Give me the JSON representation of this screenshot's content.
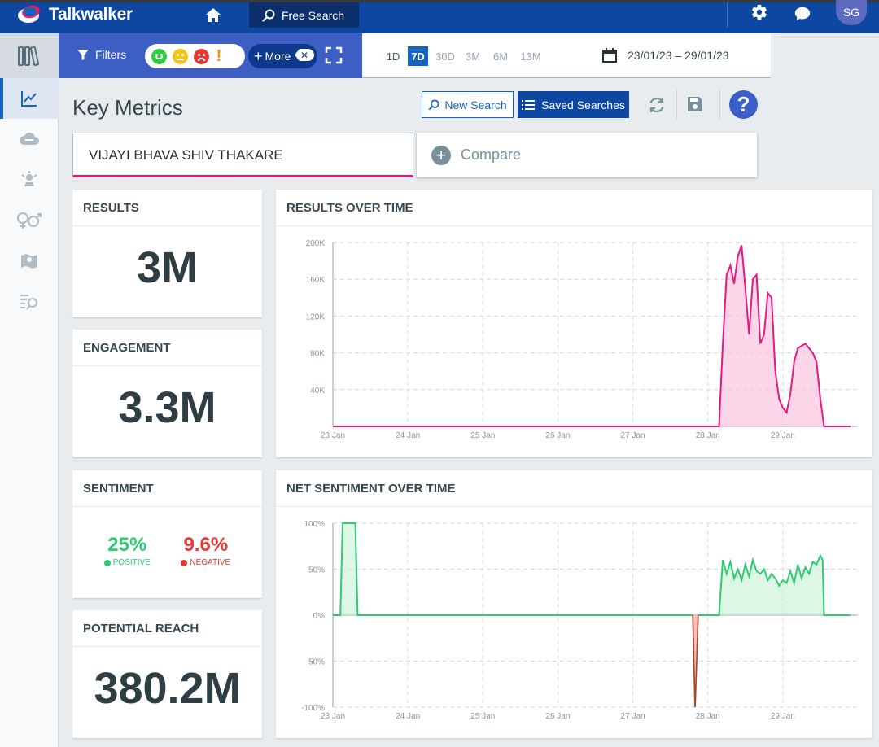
{
  "app": {
    "name": "Talkwalker",
    "free_search": "Free Search",
    "avatar": "SG"
  },
  "filters": {
    "label": "Filters",
    "more": "More",
    "more_close": "✕"
  },
  "time": {
    "ranges": [
      "1D",
      "7D",
      "30D",
      "3M",
      "6M",
      "13M"
    ],
    "selected": "7D",
    "date_range": "23/01/23 – 29/01/23"
  },
  "page": {
    "title": "Key Metrics",
    "new_search": "New Search",
    "saved_searches": "Saved Searches",
    "help": "?"
  },
  "query": {
    "value": "VIJAYI BHAVA SHIV THAKARE",
    "compare": "Compare"
  },
  "metrics": {
    "results": {
      "label": "RESULTS",
      "value": "3M"
    },
    "engagement": {
      "label": "ENGAGEMENT",
      "value": "3.3M"
    },
    "sentiment": {
      "label": "SENTIMENT",
      "positive_value": "25%",
      "positive_label": "POSITIVE",
      "negative_value": "9.6%",
      "negative_label": "NEGATIVE"
    },
    "reach": {
      "label": "POTENTIAL REACH",
      "value": "380.2M"
    }
  },
  "colors": {
    "accent": "#0d47a1",
    "pink": "#e6197f",
    "positive": "#2ecc71",
    "negative": "#e53935"
  },
  "chart_data": [
    {
      "type": "area",
      "title": "RESULTS OVER TIME",
      "x_ticks": [
        "23 Jan",
        "24 Jan",
        "25 Jan",
        "26 Jan",
        "27 Jan",
        "28 Jan",
        "29 Jan"
      ],
      "y_ticks": [
        "40K",
        "80K",
        "120K",
        "160K",
        "200K"
      ],
      "ylim": [
        0,
        200000
      ],
      "xlim": [
        0,
        7
      ],
      "grid": true,
      "series": [
        {
          "color": "#e6197f",
          "points": [
            [
              0,
              0
            ],
            [
              1,
              0
            ],
            [
              2,
              0
            ],
            [
              3,
              0
            ],
            [
              4,
              0
            ],
            [
              5,
              0
            ],
            [
              5.15,
              0
            ],
            [
              5.2,
              90000
            ],
            [
              5.25,
              165000
            ],
            [
              5.3,
              175000
            ],
            [
              5.35,
              155000
            ],
            [
              5.4,
              185000
            ],
            [
              5.45,
              197000
            ],
            [
              5.5,
              150000
            ],
            [
              5.55,
              100000
            ],
            [
              5.6,
              160000
            ],
            [
              5.65,
              165000
            ],
            [
              5.7,
              90000
            ],
            [
              5.75,
              100000
            ],
            [
              5.8,
              145000
            ],
            [
              5.85,
              140000
            ],
            [
              5.9,
              60000
            ],
            [
              5.95,
              30000
            ],
            [
              6.0,
              20000
            ],
            [
              6.05,
              15000
            ],
            [
              6.1,
              35000
            ],
            [
              6.15,
              70000
            ],
            [
              6.2,
              85000
            ],
            [
              6.3,
              90000
            ],
            [
              6.4,
              80000
            ],
            [
              6.45,
              70000
            ],
            [
              6.5,
              30000
            ],
            [
              6.55,
              0
            ],
            [
              6.9,
              0
            ]
          ]
        }
      ]
    },
    {
      "type": "area",
      "title": "NET SENTIMENT OVER TIME",
      "x_ticks": [
        "23 Jan",
        "24 Jan",
        "25 Jan",
        "26 Jan",
        "27 Jan",
        "28 Jan",
        "29 Jan"
      ],
      "y_ticks": [
        "100%",
        "50%",
        "0%",
        "-50%",
        "-100%"
      ],
      "ylim": [
        -100,
        100
      ],
      "xlim": [
        0,
        7
      ],
      "grid": true,
      "series": [
        {
          "color": "#2ecc71",
          "points": [
            [
              0,
              0
            ],
            [
              0.1,
              0
            ],
            [
              0.13,
              100
            ],
            [
              0.3,
              100
            ],
            [
              0.33,
              0
            ],
            [
              4.8,
              0
            ],
            [
              4.83,
              -100
            ],
            [
              4.87,
              0
            ],
            [
              5.15,
              0
            ],
            [
              5.2,
              60
            ],
            [
              5.25,
              45
            ],
            [
              5.3,
              58
            ],
            [
              5.35,
              40
            ],
            [
              5.4,
              50
            ],
            [
              5.45,
              38
            ],
            [
              5.5,
              55
            ],
            [
              5.55,
              42
            ],
            [
              5.6,
              60
            ],
            [
              5.65,
              48
            ],
            [
              5.7,
              45
            ],
            [
              5.75,
              50
            ],
            [
              5.8,
              38
            ],
            [
              5.85,
              45
            ],
            [
              5.9,
              40
            ],
            [
              5.95,
              32
            ],
            [
              6.0,
              38
            ],
            [
              6.05,
              35
            ],
            [
              6.1,
              48
            ],
            [
              6.15,
              35
            ],
            [
              6.2,
              55
            ],
            [
              6.25,
              40
            ],
            [
              6.3,
              52
            ],
            [
              6.35,
              45
            ],
            [
              6.4,
              58
            ],
            [
              6.45,
              55
            ],
            [
              6.5,
              65
            ],
            [
              6.53,
              60
            ],
            [
              6.55,
              0
            ],
            [
              6.9,
              0
            ]
          ]
        }
      ]
    }
  ]
}
